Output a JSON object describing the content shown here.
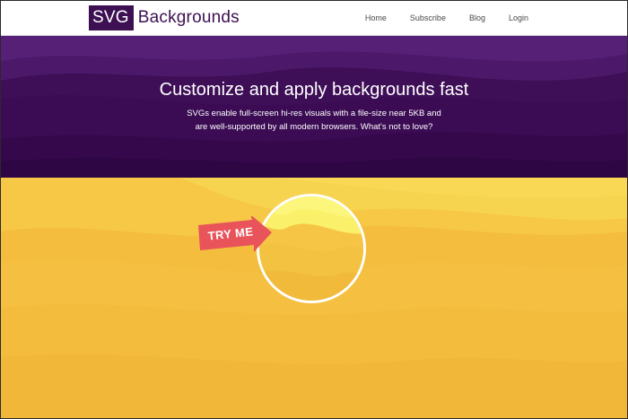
{
  "header": {
    "logo": {
      "box_text": "SVG",
      "word_text": "Backgrounds"
    },
    "nav": [
      {
        "label": "Home"
      },
      {
        "label": "Subscribe"
      },
      {
        "label": "Blog"
      },
      {
        "label": "Login"
      }
    ]
  },
  "hero": {
    "title": "Customize and apply backgrounds fast",
    "subtitle_lines": [
      "SVGs enable full-screen hi-res visuals with a file-size near 5KB and",
      "are well-supported by all modern browsers. What's not to love?"
    ]
  },
  "stage": {
    "try_me_label": "TRY ME"
  },
  "colors": {
    "brand_purple": "#3c1053",
    "hero_purple": "#3e0e57",
    "yellow": "#f6c443",
    "try_me_red": "#e8545a",
    "white": "#ffffff"
  },
  "icons": {
    "try_me": "arrow-right-icon",
    "preview": "circle-preview-icon"
  }
}
